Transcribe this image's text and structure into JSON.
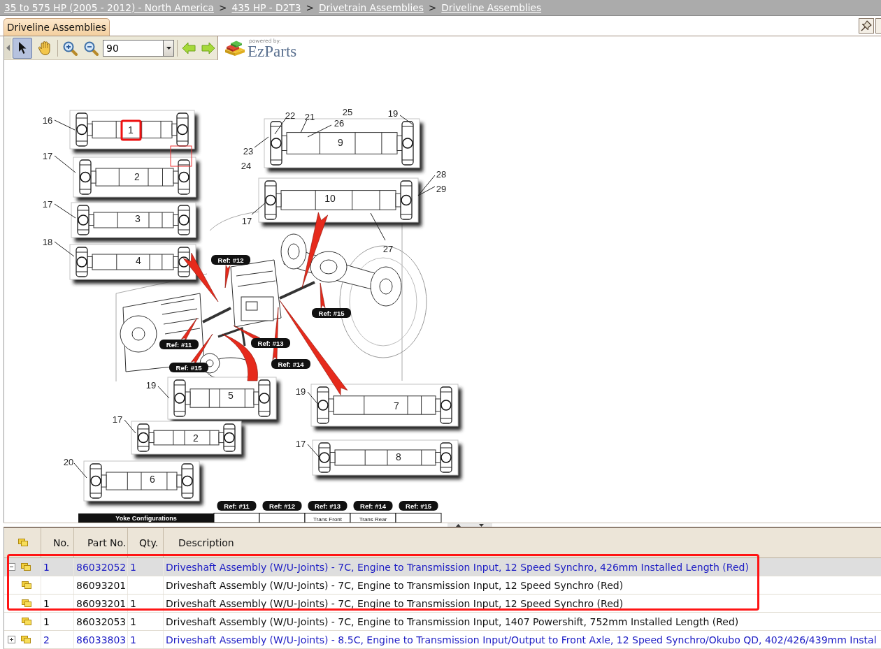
{
  "breadcrumb": {
    "items": [
      {
        "kind": "link",
        "text": "35 to 575 HP (2005 - 2012) - North America"
      },
      {
        "kind": "separator",
        "text": ">"
      },
      {
        "kind": "link",
        "text": "435 HP - D2T3"
      },
      {
        "kind": "separator",
        "text": ">"
      },
      {
        "kind": "link",
        "text": "Drivetrain Assemblies"
      },
      {
        "kind": "separator",
        "text": ">"
      },
      {
        "kind": "link",
        "text": "Driveline Assemblies"
      }
    ]
  },
  "tabs": [
    {
      "label": "Driveline Assemblies",
      "selected": true
    }
  ],
  "toolbar": {
    "tools": [
      {
        "kind": "pointer",
        "selected": true
      },
      {
        "kind": "pan",
        "selected": false
      }
    ],
    "zoom": {
      "value": "90"
    }
  },
  "logo": {
    "tagline": "powered by:",
    "name": "EzParts"
  },
  "diagram": {
    "shafts": [
      {
        "number": "1",
        "selected": true
      },
      {
        "number": "9",
        "selected": false
      },
      {
        "number": "2",
        "selected": false
      },
      {
        "number": "10",
        "selected": false
      },
      {
        "number": "3",
        "selected": false
      },
      {
        "number": "4",
        "selected": false
      },
      {
        "number": "5",
        "selected": false
      },
      {
        "number": "7",
        "selected": false
      },
      {
        "number": "2",
        "selected": false
      },
      {
        "number": "8",
        "selected": false
      },
      {
        "number": "6",
        "selected": false
      }
    ],
    "callouts": [
      "16",
      "22",
      "21",
      "25",
      "19",
      "26",
      "17",
      "23",
      "24",
      "28",
      "29",
      "17",
      "17",
      "18",
      "27",
      "19",
      "19",
      "17",
      "17",
      "20"
    ],
    "ref_tags": [
      "Ref: #12",
      "Ref: #15",
      "Ref: #11",
      "Ref: #13",
      "Ref: #15",
      "Ref: #14"
    ],
    "yoke_table": {
      "title": "Yoke Configurations",
      "columns": [
        {
          "ref": "Ref: #11"
        },
        {
          "ref": "Ref: #12"
        },
        {
          "ref": "Ref: #13",
          "text": "Trans Front"
        },
        {
          "ref": "Ref: #14",
          "text": "Trans Rear"
        },
        {
          "ref": "Ref: #15"
        }
      ]
    }
  },
  "parts_table": {
    "columns": [
      "No.",
      "Part No.",
      "Qty.",
      "Description"
    ],
    "rows": [
      {
        "kind": "assembly",
        "expanded": true,
        "selected": true,
        "highlighted": true,
        "no": "1",
        "part_no": "86032052",
        "qty": "1",
        "description": "Driveshaft Assembly (W/U-Joints) - 7C, Engine to Transmission Input, 12 Speed Synchro, 426mm Installed Length (Red)",
        "children": [
          {
            "kind": "part",
            "selected": false,
            "highlighted": true,
            "part_no": "86093201",
            "description": "Driveshaft Assembly (W/U-Joints) - 7C, Engine to Transmission Input, 12 Speed Synchro (Red)"
          },
          {
            "kind": "part",
            "selected": false,
            "highlighted": true,
            "no": "1",
            "part_no": "86093201",
            "qty": "1",
            "description": "Driveshaft Assembly (W/U-Joints) - 7C, Engine to Transmission Input, 12 Speed Synchro (Red)"
          }
        ]
      },
      {
        "kind": "part",
        "selected": false,
        "highlighted": false,
        "no": "1",
        "part_no": "86032053",
        "qty": "1",
        "description": "Driveshaft Assembly (W/U-Joints) - 7C, Engine to Transmission Input, 1407 Powershift, 752mm Installed Length (Red)"
      },
      {
        "kind": "assembly",
        "expanded": false,
        "selected": false,
        "highlighted": false,
        "no": "2",
        "part_no": "86033803",
        "qty": "1",
        "description": "Driveshaft Assembly (W/U-Joints) - 8.5C, Engine to Transmission Input/Output to Front Axle, 12 Speed Synchro/Okubo QD, 402/426/439mm Instal"
      }
    ]
  }
}
